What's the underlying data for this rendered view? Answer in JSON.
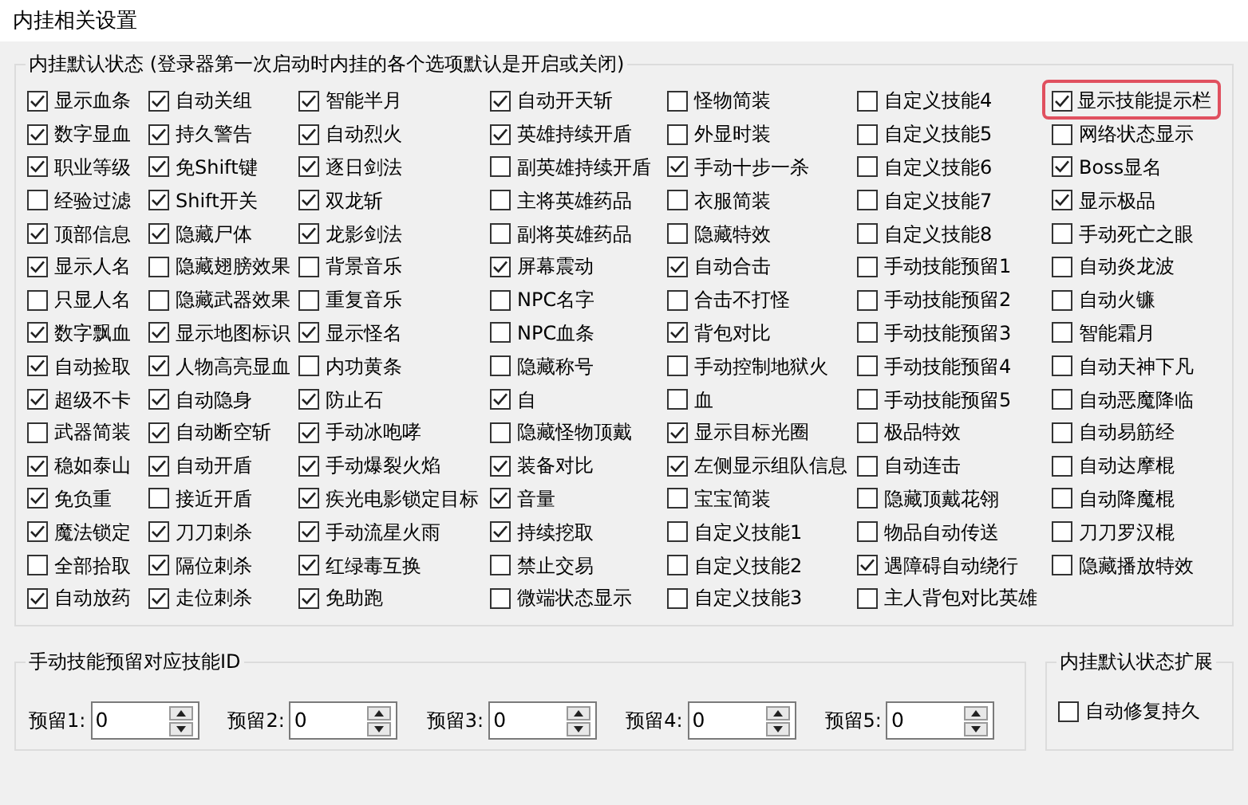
{
  "window": {
    "title": "内挂相关设置"
  },
  "defaults_group": {
    "title": "内挂默认状态 (登录器第一次启动时内挂的各个选项默认是开启或关闭)",
    "columns": [
      [
        {
          "label": "显示血条",
          "checked": true
        },
        {
          "label": "数字显血",
          "checked": true
        },
        {
          "label": "职业等级",
          "checked": true
        },
        {
          "label": "经验过滤",
          "checked": false
        },
        {
          "label": "顶部信息",
          "checked": true
        },
        {
          "label": "显示人名",
          "checked": true
        },
        {
          "label": "只显人名",
          "checked": false
        },
        {
          "label": "数字飘血",
          "checked": true
        },
        {
          "label": "自动捡取",
          "checked": true
        },
        {
          "label": "超级不卡",
          "checked": true
        },
        {
          "label": "武器简装",
          "checked": false
        },
        {
          "label": "稳如泰山",
          "checked": true
        },
        {
          "label": "免负重",
          "checked": true
        },
        {
          "label": "魔法锁定",
          "checked": true
        },
        {
          "label": "全部拾取",
          "checked": false
        },
        {
          "label": "自动放药",
          "checked": true
        }
      ],
      [
        {
          "label": "自动关组",
          "checked": true
        },
        {
          "label": "持久警告",
          "checked": true
        },
        {
          "label": "免Shift键",
          "checked": true
        },
        {
          "label": "Shift开关",
          "checked": true
        },
        {
          "label": "隐藏尸体",
          "checked": true
        },
        {
          "label": "隐藏翅膀效果",
          "checked": false
        },
        {
          "label": "隐藏武器效果",
          "checked": false
        },
        {
          "label": "显示地图标识",
          "checked": true
        },
        {
          "label": "人物高亮显血",
          "checked": true
        },
        {
          "label": "自动隐身",
          "checked": true
        },
        {
          "label": "自动断空斩",
          "checked": true
        },
        {
          "label": "自动开盾",
          "checked": true
        },
        {
          "label": "接近开盾",
          "checked": false
        },
        {
          "label": "刀刀刺杀",
          "checked": true
        },
        {
          "label": "隔位刺杀",
          "checked": true
        },
        {
          "label": "走位刺杀",
          "checked": true
        }
      ],
      [
        {
          "label": "智能半月",
          "checked": true
        },
        {
          "label": "自动烈火",
          "checked": true
        },
        {
          "label": "逐日剑法",
          "checked": true
        },
        {
          "label": "双龙斩",
          "checked": true
        },
        {
          "label": "龙影剑法",
          "checked": true
        },
        {
          "label": "背景音乐",
          "checked": false
        },
        {
          "label": "重复音乐",
          "checked": false
        },
        {
          "label": "显示怪名",
          "checked": true
        },
        {
          "label": "内功黄条",
          "checked": false
        },
        {
          "label": "防止石",
          "checked": true
        },
        {
          "label": "手动冰咆哮",
          "checked": true
        },
        {
          "label": "手动爆裂火焰",
          "checked": true
        },
        {
          "label": "疾光电影锁定目标",
          "checked": true
        },
        {
          "label": "手动流星火雨",
          "checked": true
        },
        {
          "label": "红绿毒互换",
          "checked": true
        },
        {
          "label": "免助跑",
          "checked": true
        }
      ],
      [
        {
          "label": "自动开天斩",
          "checked": true
        },
        {
          "label": "英雄持续开盾",
          "checked": true
        },
        {
          "label": "副英雄持续开盾",
          "checked": false
        },
        {
          "label": "主将英雄药品",
          "checked": false
        },
        {
          "label": "副将英雄药品",
          "checked": false
        },
        {
          "label": "屏幕震动",
          "checked": true
        },
        {
          "label": "NPC名字",
          "checked": false
        },
        {
          "label": "NPC血条",
          "checked": false
        },
        {
          "label": "隐藏称号",
          "checked": false
        },
        {
          "label": "自",
          "checked": true
        },
        {
          "label": "隐藏怪物顶戴",
          "checked": false
        },
        {
          "label": "装备对比",
          "checked": true
        },
        {
          "label": "音量",
          "checked": true
        },
        {
          "label": "持续挖取",
          "checked": true
        },
        {
          "label": "禁止交易",
          "checked": false
        },
        {
          "label": "微端状态显示",
          "checked": false
        }
      ],
      [
        {
          "label": "怪物简装",
          "checked": false
        },
        {
          "label": "外显时装",
          "checked": false
        },
        {
          "label": "手动十步一杀",
          "checked": true
        },
        {
          "label": "衣服简装",
          "checked": false
        },
        {
          "label": "隐藏特效",
          "checked": false
        },
        {
          "label": "自动合击",
          "checked": true
        },
        {
          "label": "合击不打怪",
          "checked": false
        },
        {
          "label": "背包对比",
          "checked": true
        },
        {
          "label": "手动控制地狱火",
          "checked": false
        },
        {
          "label": "血",
          "checked": false
        },
        {
          "label": "显示目标光圈",
          "checked": true
        },
        {
          "label": "左侧显示组队信息",
          "checked": true
        },
        {
          "label": "宝宝简装",
          "checked": false
        },
        {
          "label": "自定义技能1",
          "checked": false
        },
        {
          "label": "自定义技能2",
          "checked": false
        },
        {
          "label": "自定义技能3",
          "checked": false
        }
      ],
      [
        {
          "label": "自定义技能4",
          "checked": false
        },
        {
          "label": "自定义技能5",
          "checked": false
        },
        {
          "label": "自定义技能6",
          "checked": false
        },
        {
          "label": "自定义技能7",
          "checked": false
        },
        {
          "label": "自定义技能8",
          "checked": false
        },
        {
          "label": "手动技能预留1",
          "checked": false
        },
        {
          "label": "手动技能预留2",
          "checked": false
        },
        {
          "label": "手动技能预留3",
          "checked": false
        },
        {
          "label": "手动技能预留4",
          "checked": false
        },
        {
          "label": "手动技能预留5",
          "checked": false
        },
        {
          "label": "极品特效",
          "checked": false
        },
        {
          "label": "自动连击",
          "checked": false
        },
        {
          "label": "隐藏顶戴花翎",
          "checked": false
        },
        {
          "label": "物品自动传送",
          "checked": false
        },
        {
          "label": "遇障碍自动绕行",
          "checked": true
        },
        {
          "label": "主人背包对比英雄",
          "checked": false
        }
      ],
      [
        {
          "label": "显示技能提示栏",
          "checked": true,
          "highlighted": true
        },
        {
          "label": "网络状态显示",
          "checked": false
        },
        {
          "label": "Boss显名",
          "checked": true
        },
        {
          "label": "显示极品",
          "checked": true
        },
        {
          "label": "手动死亡之眼",
          "checked": false
        },
        {
          "label": "自动炎龙波",
          "checked": false
        },
        {
          "label": "自动火镰",
          "checked": false
        },
        {
          "label": "智能霜月",
          "checked": false
        },
        {
          "label": "自动天神下凡",
          "checked": false
        },
        {
          "label": "自动恶魔降临",
          "checked": false
        },
        {
          "label": "自动易筋经",
          "checked": false
        },
        {
          "label": "自动达摩棍",
          "checked": false
        },
        {
          "label": "自动降魔棍",
          "checked": false
        },
        {
          "label": "刀刀罗汉棍",
          "checked": false
        },
        {
          "label": "隐藏播放特效",
          "checked": false
        }
      ]
    ]
  },
  "skill_id_group": {
    "title": "手动技能预留对应技能ID",
    "fields": [
      {
        "label": "预留1:",
        "value": "0"
      },
      {
        "label": "预留2:",
        "value": "0"
      },
      {
        "label": "预留3:",
        "value": "0"
      },
      {
        "label": "预留4:",
        "value": "0"
      },
      {
        "label": "预留5:",
        "value": "0"
      }
    ]
  },
  "extension_group": {
    "title": "内挂默认状态扩展",
    "items": [
      {
        "label": "自动修复持久",
        "checked": false
      }
    ]
  }
}
